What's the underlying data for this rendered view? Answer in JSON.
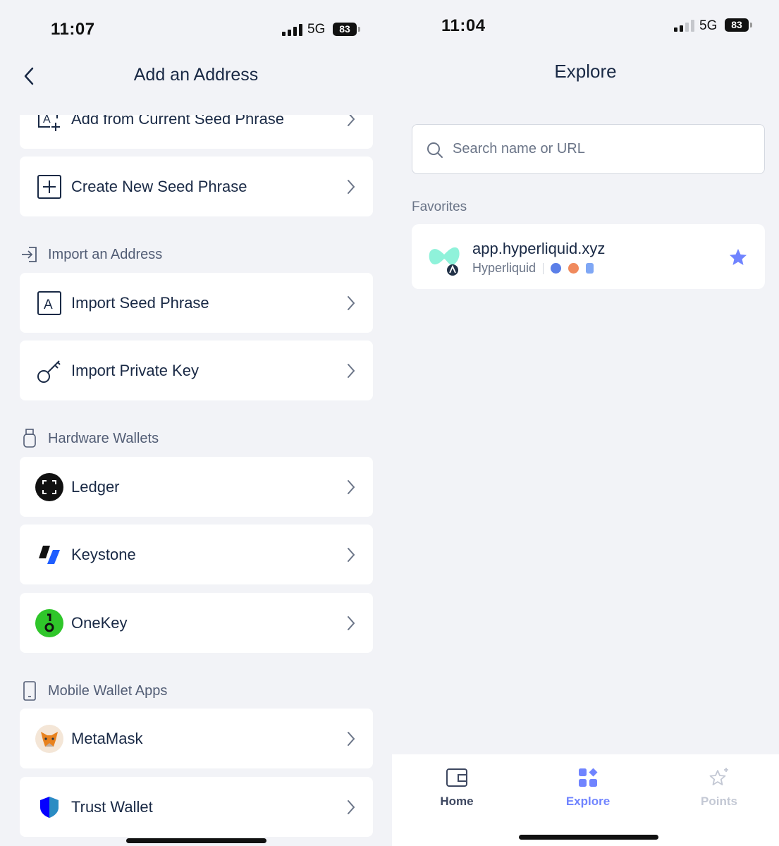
{
  "left_screen": {
    "status": {
      "time": "11:07",
      "network": "5G",
      "battery": "83"
    },
    "header": {
      "title": "Add an Address",
      "back_icon": "chevron-left-icon"
    },
    "rows_top": [
      {
        "label": "Add from Current Seed Phrase",
        "icon": "add-seed-icon"
      },
      {
        "label": "Create New Seed Phrase",
        "icon": "plus-square-icon"
      }
    ],
    "import_section": {
      "title": "Import an Address",
      "items": [
        {
          "label": "Import Seed Phrase",
          "icon": "letter-a-box-icon"
        },
        {
          "label": "Import Private Key",
          "icon": "key-icon"
        }
      ]
    },
    "hardware_section": {
      "title": "Hardware Wallets",
      "items": [
        {
          "label": "Ledger",
          "icon": "ledger-logo-icon"
        },
        {
          "label": "Keystone",
          "icon": "keystone-logo-icon"
        },
        {
          "label": "OneKey",
          "icon": "onekey-logo-icon"
        }
      ]
    },
    "mobile_section": {
      "title": "Mobile Wallet Apps",
      "items": [
        {
          "label": "MetaMask",
          "icon": "metamask-fox-icon"
        },
        {
          "label": "Trust Wallet",
          "icon": "trust-wallet-shield-icon"
        }
      ]
    }
  },
  "right_screen": {
    "status": {
      "time": "11:04",
      "network": "5G",
      "battery": "83"
    },
    "header": {
      "title": "Explore"
    },
    "search": {
      "placeholder": "Search name or URL"
    },
    "favorites": {
      "label": "Favorites",
      "items": [
        {
          "url": "app.hyperliquid.xyz",
          "name": "Hyperliquid",
          "favorited": true
        }
      ]
    },
    "tabbar": [
      {
        "label": "Home",
        "icon": "wallet-icon",
        "active": false
      },
      {
        "label": "Explore",
        "icon": "apps-grid-icon",
        "active": true
      },
      {
        "label": "Points",
        "icon": "sparkle-star-icon",
        "active": false
      }
    ]
  },
  "colors": {
    "accent": "#7084ff",
    "background": "#f2f3f7",
    "text": "#192945",
    "muted": "#6a7487"
  }
}
